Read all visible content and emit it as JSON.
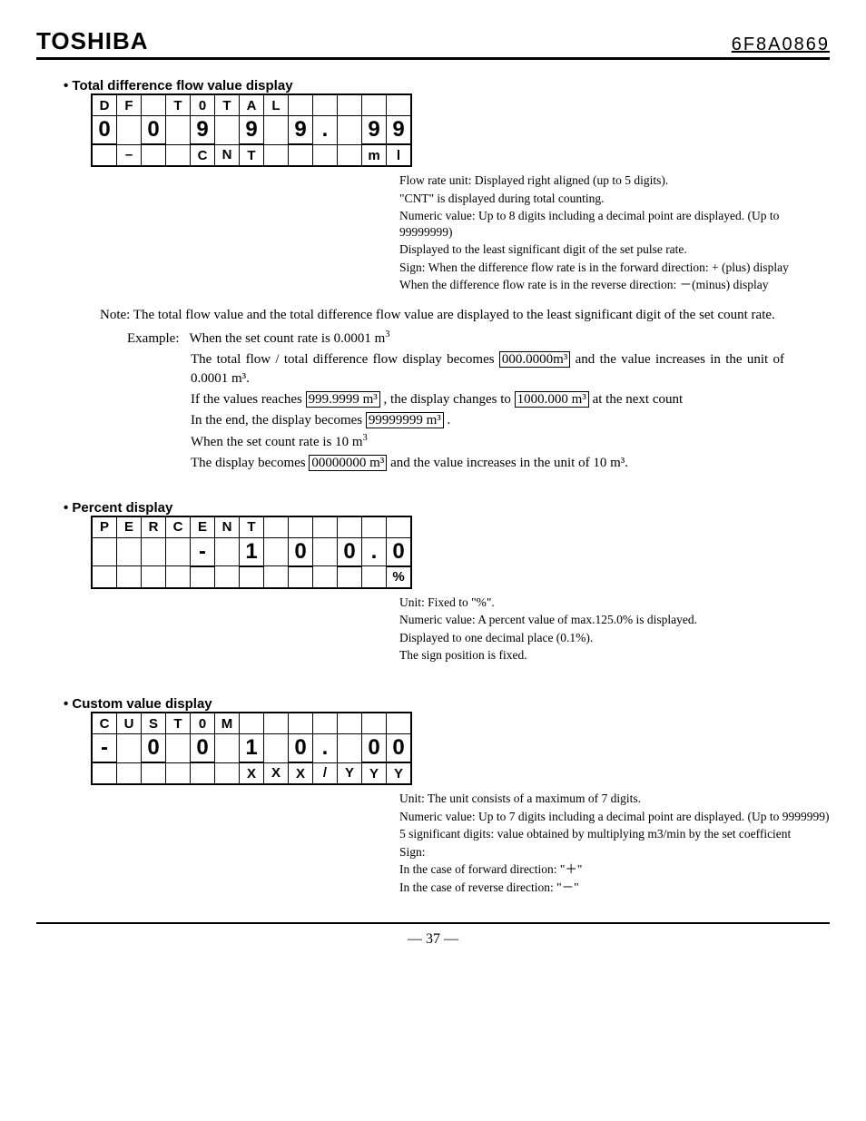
{
  "header": {
    "brand": "TOSHIBA",
    "docnum": "6F8A0869"
  },
  "section1": {
    "title": "Total difference flow value display",
    "lcd": {
      "row1": [
        "D",
        "F",
        "",
        "T",
        "0",
        "T",
        "A",
        "L",
        "",
        "",
        "",
        "",
        ""
      ],
      "row2": [
        "0",
        "",
        "0",
        "",
        "9",
        "",
        "9",
        "",
        "9",
        ".",
        "",
        "9",
        "9"
      ],
      "row3": [
        "",
        "–",
        "",
        "",
        "C",
        "N",
        "T",
        "",
        "",
        "",
        "",
        "m",
        "l"
      ]
    },
    "anno": [
      "Flow rate unit: Displayed right aligned (up to 5 digits).",
      "\"CNT\" is displayed during total counting.",
      "Numeric value: Up to 8 digits including a decimal point are displayed.   (Up to 99999999)",
      "Displayed to the least significant digit of the set pulse rate.",
      "Sign: When the difference flow rate is in the forward direction: + (plus) display",
      "When the difference flow rate is in the reverse direction:  －(minus) display"
    ]
  },
  "note": {
    "lead1": "Note: The total flow value and the total difference flow value are displayed to the least significant digit of the set count rate.",
    "ex_label": "Example:",
    "ex1_a": "When the set count rate is 0.0001 m",
    "ex1_b": "The total flow / total difference flow display becomes ",
    "ex1_box1": "000.0000m³",
    "ex1_c": " and the value increases in the unit of 0.0001 m³.",
    "ex1_d_pre": "If the values reaches ",
    "ex1_box2": "999.9999 m³",
    "ex1_d_mid": ", the display changes to ",
    "ex1_box3": "1000.000 m³",
    "ex1_d_post": " at the next count",
    "ex1_e_pre": "In the end, the display becomes ",
    "ex1_box4": "99999999 m³",
    "ex1_e_post": ".",
    "ex2_a": "When the set count rate is 10 m",
    "ex2_b_pre": "The display becomes ",
    "ex2_box1": "00000000 m³",
    "ex2_b_post": " and the value increases in the unit of 10 m³."
  },
  "section2": {
    "title": "Percent display",
    "lcd": {
      "row1": [
        "P",
        "E",
        "R",
        "C",
        "E",
        "N",
        "T",
        "",
        "",
        "",
        "",
        "",
        ""
      ],
      "row2": [
        "",
        "",
        "",
        "",
        "-",
        "",
        "1",
        "",
        "0",
        "",
        "0",
        ".",
        "0"
      ],
      "row3": [
        "",
        "",
        "",
        "",
        "",
        "",
        "",
        "",
        "",
        "",
        "",
        "",
        "%"
      ]
    },
    "anno": [
      "Unit: Fixed to \"%\".",
      "Numeric value: A percent value of max.125.0% is displayed.",
      "Displayed to one decimal place (0.1%).",
      "The sign position is fixed."
    ]
  },
  "section3": {
    "title": "Custom value display",
    "lcd": {
      "row1": [
        "C",
        "U",
        "S",
        "T",
        "0",
        "M",
        "",
        "",
        "",
        "",
        "",
        "",
        ""
      ],
      "row2": [
        "-",
        "",
        "0",
        "",
        "0",
        "",
        "1",
        "",
        "0",
        ".",
        "",
        "0",
        "0"
      ],
      "row3": [
        "",
        "",
        "",
        "",
        "",
        "",
        "X",
        "X",
        "X",
        "/",
        "Y",
        "Y",
        "Y"
      ]
    },
    "anno": [
      "Unit: The unit consists of a maximum of 7 digits.",
      "Numeric value: Up to 7 digits including a decimal point are displayed.   (Up to 9999999)",
      "5 significant digits: value obtained by multiplying m3/min by the set coefficient",
      "Sign:",
      "  In the case of forward direction: \"＋\"",
      "  In the case of reverse direction: \"－\""
    ]
  },
  "footer": {
    "page": "—   37   —"
  }
}
